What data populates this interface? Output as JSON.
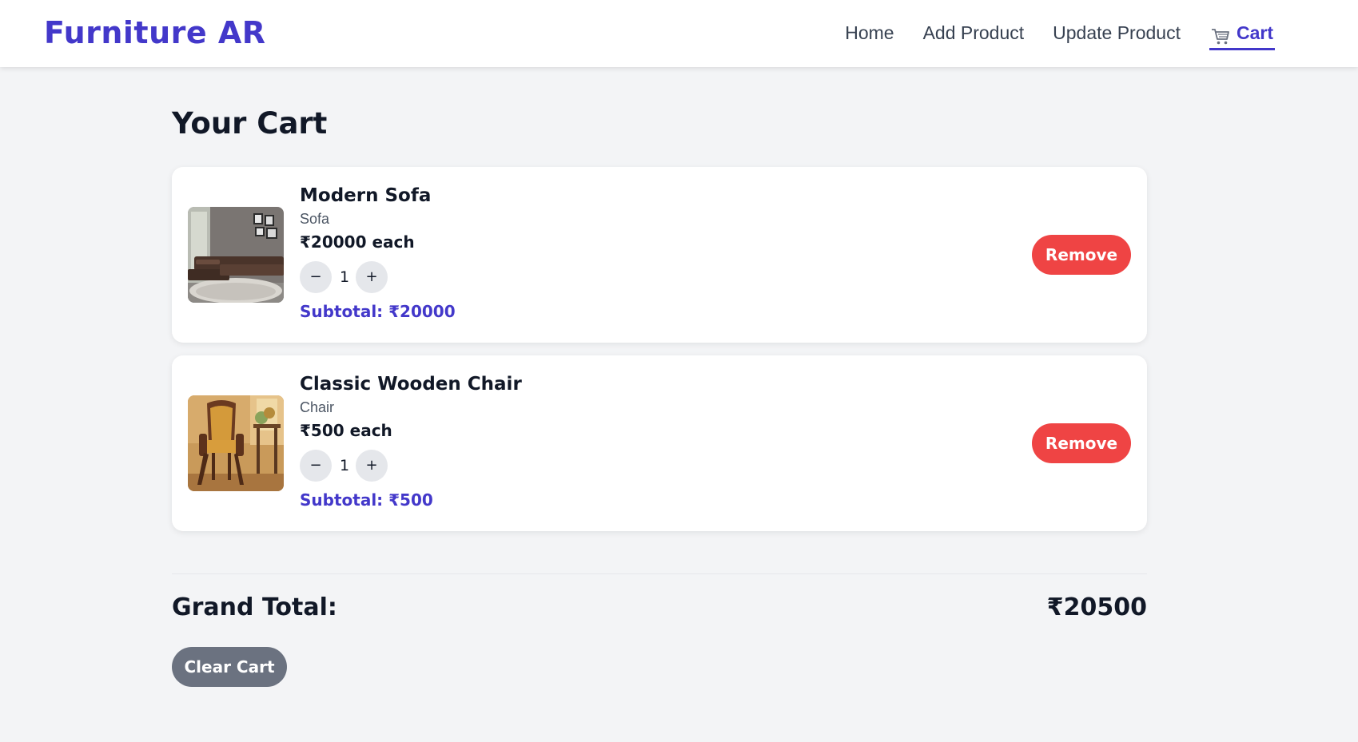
{
  "brand": {
    "name": "Furniture AR"
  },
  "nav": {
    "home": "Home",
    "add_product": "Add Product",
    "update_product": "Update Product",
    "cart": "Cart",
    "cart_icon": "shopping-cart-icon"
  },
  "page": {
    "title": "Your Cart"
  },
  "items": [
    {
      "name": "Modern Sofa",
      "category": "Sofa",
      "price": "₹20000 each",
      "quantity": "1",
      "subtotal": "Subtotal: ₹20000",
      "decrement": "−",
      "increment": "+",
      "remove": "Remove"
    },
    {
      "name": "Classic Wooden Chair",
      "category": "Chair",
      "price": "₹500 each",
      "quantity": "1",
      "subtotal": "Subtotal: ₹500",
      "decrement": "−",
      "increment": "+",
      "remove": "Remove"
    }
  ],
  "summary": {
    "grand_total_label": "Grand Total:",
    "grand_total_value": "₹20500",
    "clear_cart": "Clear Cart"
  },
  "colors": {
    "accent": "#4338ca",
    "danger": "#ef4444",
    "neutral_button": "#6b7280",
    "background": "#f3f4f6"
  }
}
